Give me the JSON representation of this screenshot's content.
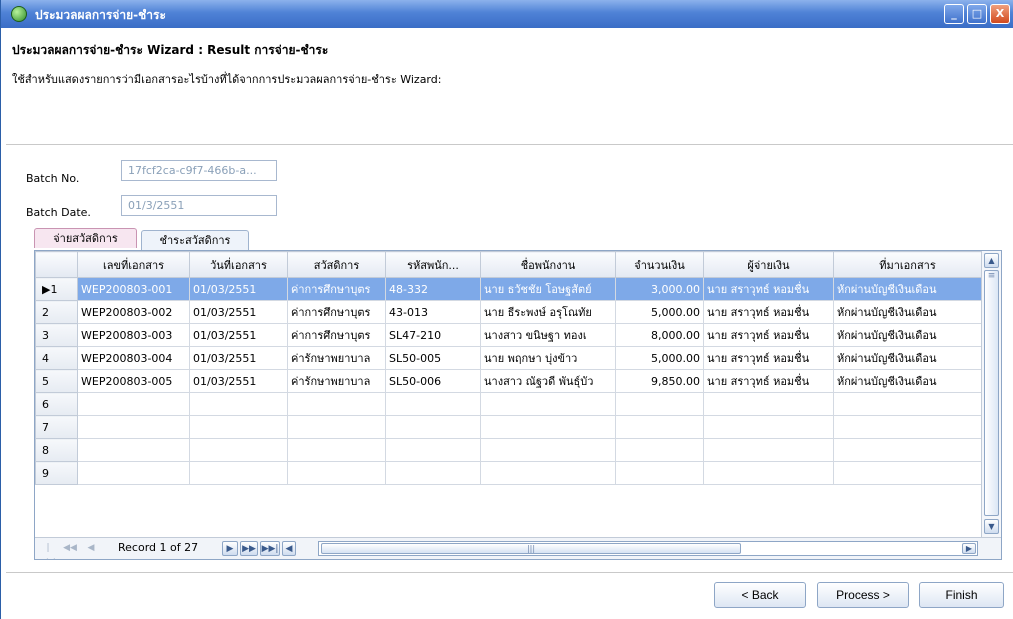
{
  "window": {
    "title": "ประมวลผลการจ่าย-ชำระ",
    "controls": [
      "_",
      "□",
      "X"
    ]
  },
  "wizard": {
    "title": "ประมวลผลการจ่าย-ชำระ Wizard : Result การจ่าย-ชำระ",
    "description": "ใช้สำหรับแสดงรายการว่ามีเอกสารอะไรบ้างที่ได้จากการประมวลผลการจ่าย-ชำระ Wizard:"
  },
  "fields": {
    "batch_no_label": "Batch No.",
    "batch_no_value": "17fcf2ca-c9f7-466b-a...",
    "batch_date_label": "Batch Date.",
    "batch_date_value": "01/3/2551"
  },
  "tabs": [
    {
      "label": "จ่ายสวัสดิการ",
      "active": true
    },
    {
      "label": "ชำระสวัสดิการ",
      "active": false
    }
  ],
  "grid": {
    "columns": [
      "",
      "เลขที่เอกสาร",
      "วันที่เอกสาร",
      "สวัสดิการ",
      "รหัสพนัก...",
      "ชื่อพนักงาน",
      "จำนวนเงิน",
      "ผู้จ่ายเงิน",
      "ที่มาเอกสาร"
    ],
    "rows": [
      {
        "rownum": "1",
        "marker": "▶",
        "doc_no": "WEP200803-001",
        "doc_date": "01/03/2551",
        "welfare": "ค่าการศึกษาบุตร",
        "emp_code": "48-332",
        "emp_name": "นาย ธวัชชัย โอษฐสัตย์",
        "amount": "3,000.00",
        "payer": "นาย สราวุทธ์ หอมชื่น",
        "source": "หักผ่านบัญชีเงินเดือน"
      },
      {
        "rownum": "2",
        "marker": "",
        "doc_no": "WEP200803-002",
        "doc_date": "01/03/2551",
        "welfare": "ค่าการศึกษาบุตร",
        "emp_code": "43-013",
        "emp_name": "นาย ธีระพงษ์ อรุโณทัย",
        "amount": "5,000.00",
        "payer": "นาย สราวุทธ์ หอมชื่น",
        "source": "หักผ่านบัญชีเงินเดือน"
      },
      {
        "rownum": "3",
        "marker": "",
        "doc_no": "WEP200803-003",
        "doc_date": "01/03/2551",
        "welfare": "ค่าการศึกษาบุตร",
        "emp_code": "SL47-210",
        "emp_name": "นางสาว ขนิษฐา ทองเ",
        "amount": "8,000.00",
        "payer": "นาย สราวุทธ์ หอมชื่น",
        "source": "หักผ่านบัญชีเงินเดือน"
      },
      {
        "rownum": "4",
        "marker": "",
        "doc_no": "WEP200803-004",
        "doc_date": "01/03/2551",
        "welfare": "ค่ารักษาพยาบาล",
        "emp_code": "SL50-005",
        "emp_name": "นาย พฤกษา บุ่งข้าว",
        "amount": "5,000.00",
        "payer": "นาย สราวุทธ์ หอมชื่น",
        "source": "หักผ่านบัญชีเงินเดือน"
      },
      {
        "rownum": "5",
        "marker": "",
        "doc_no": "WEP200803-005",
        "doc_date": "01/03/2551",
        "welfare": "ค่ารักษาพยาบาล",
        "emp_code": "SL50-006",
        "emp_name": "นางสาว ณัฐวดี พันธุ์บัว",
        "amount": "9,850.00",
        "payer": "นาย สราวุทธ์ หอมชื่น",
        "source": "หักผ่านบัญชีเงินเดือน"
      },
      {
        "rownum": "6",
        "marker": "",
        "doc_no": "",
        "doc_date": "",
        "welfare": "",
        "emp_code": "",
        "emp_name": "",
        "amount": "",
        "payer": "",
        "source": ""
      },
      {
        "rownum": "7",
        "marker": "",
        "doc_no": "",
        "doc_date": "",
        "welfare": "",
        "emp_code": "",
        "emp_name": "",
        "amount": "",
        "payer": "",
        "source": ""
      },
      {
        "rownum": "8",
        "marker": "",
        "doc_no": "",
        "doc_date": "",
        "welfare": "",
        "emp_code": "",
        "emp_name": "",
        "amount": "",
        "payer": "",
        "source": ""
      },
      {
        "rownum": "9",
        "marker": "",
        "doc_no": "",
        "doc_date": "",
        "welfare": "",
        "emp_code": "",
        "emp_name": "",
        "amount": "",
        "payer": "",
        "source": ""
      }
    ],
    "selected_row": 1,
    "record_text": "Record 1 of 27"
  },
  "navigator": {
    "icons": [
      "first-icon",
      "prev-page-icon",
      "prev-icon",
      "next-icon",
      "next-page-icon",
      "last-icon",
      "scroll-left-icon"
    ]
  },
  "buttons": {
    "back": "< Back",
    "process": "Process >",
    "finish": "Finish"
  },
  "colors": {
    "titlebar": "#3a6dc6",
    "selected_row": "#7ea9e8",
    "active_tab": "#f7e6f0"
  }
}
